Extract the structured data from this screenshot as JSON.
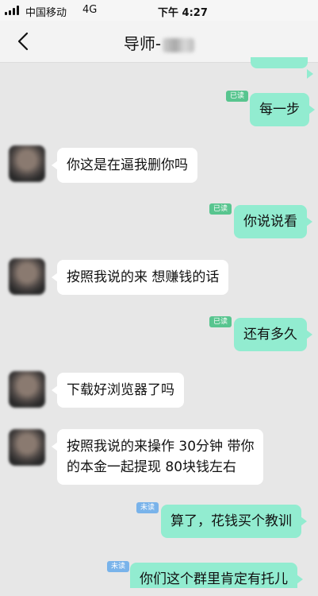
{
  "status_bar": {
    "carrier": "中国移动",
    "network": "4G",
    "time": "下午 4:27"
  },
  "nav": {
    "title": "导师-",
    "back_icon": "chevron-left-icon"
  },
  "messages": [
    {
      "side": "right",
      "text": "每一步",
      "badge": "已读"
    },
    {
      "side": "left",
      "text": "你这是在逼我删你吗"
    },
    {
      "side": "right",
      "text": "你说说看",
      "badge": "已读"
    },
    {
      "side": "left",
      "text": "按照我说的来  想赚钱的话"
    },
    {
      "side": "right",
      "text": "还有多久",
      "badge": "已读"
    },
    {
      "side": "left",
      "text": "下载好浏览器了吗"
    },
    {
      "side": "left",
      "lines": [
        "按照我说的来操作  30分钟 带你",
        "的本金一起提现 80块钱左右"
      ]
    },
    {
      "side": "right",
      "text": "算了，花钱买个教训",
      "badge": "未读"
    },
    {
      "side": "right",
      "text": "你们这个群里肯定有托儿",
      "badge": "未读"
    }
  ],
  "colors": {
    "background": "#e7e7e7",
    "bubble_self": "#92ecd0",
    "bubble_other": "#ffffff",
    "badge_read": "#58c58f",
    "badge_unread": "#79b3ea"
  }
}
